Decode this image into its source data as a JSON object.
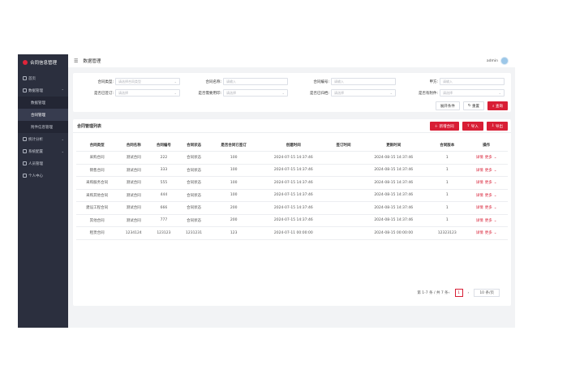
{
  "app": {
    "title": "合同信息管理"
  },
  "header": {
    "page_title": "数据管理",
    "username": "admin"
  },
  "sidebar": {
    "items": [
      {
        "label": "首页"
      },
      {
        "label": "数据管理",
        "expanded": true,
        "subs": [
          {
            "label": "数据管理"
          },
          {
            "label": "合同管理",
            "active": true
          },
          {
            "label": "附件信息管理"
          }
        ]
      },
      {
        "label": "统计分析"
      },
      {
        "label": "系统配置"
      },
      {
        "label": "人员管理"
      },
      {
        "label": "个人中心"
      }
    ]
  },
  "filter": {
    "fields": [
      {
        "label": "合同类型:",
        "placeholder": "请选择合同类型"
      },
      {
        "label": "合同名称:",
        "placeholder": "请输入"
      },
      {
        "label": "合同编号:",
        "placeholder": "请输入"
      },
      {
        "label": "甲方:",
        "placeholder": "请输入"
      },
      {
        "label": "是否已签订:",
        "placeholder": "请选择"
      },
      {
        "label": "是否需要用印:",
        "placeholder": "请选择"
      },
      {
        "label": "是否已归档:",
        "placeholder": "请选择"
      },
      {
        "label": "是否有附件:",
        "placeholder": "请选择"
      }
    ],
    "buttons": {
      "expand": "展开条件",
      "reset": "重置",
      "search": "查询"
    }
  },
  "panel": {
    "title": "合同管理列表",
    "actions": {
      "add": "新增合同",
      "import": "导入",
      "export": "导出"
    }
  },
  "table": {
    "headers": [
      "合同类型",
      "合同名称",
      "合同编号",
      "合同状态",
      "是否合同已签订",
      "创建时间",
      "签订时间",
      "更新时间",
      "合同版本",
      "操作"
    ],
    "rows": [
      [
        "采购合同",
        "测试合同",
        "222",
        "合同状态",
        "100",
        "2024-07-15 14:37:46",
        "",
        "2024-08-15 14:37:46",
        "1"
      ],
      [
        "销售合同",
        "测试合同",
        "333",
        "合同状态",
        "100",
        "2024-07-15 14:37:46",
        "",
        "2024-08-15 14:37:46",
        "1"
      ],
      [
        "采购服务合同",
        "测试合同",
        "555",
        "合同状态",
        "100",
        "2024-07-15 14:37:46",
        "",
        "2024-08-15 14:37:46",
        "1"
      ],
      [
        "采购其他合同",
        "测试合同",
        "444",
        "合同状态",
        "100",
        "2024-07-15 14:37:46",
        "",
        "2024-08-15 14:37:46",
        "1"
      ],
      [
        "建设工程合同",
        "测试合同",
        "666",
        "合同状态",
        "200",
        "2024-07-15 14:37:46",
        "",
        "2024-08-15 14:37:46",
        "1"
      ],
      [
        "其他合同",
        "测试合同",
        "777",
        "合同状态",
        "200",
        "2024-07-15 14:37:46",
        "",
        "2024-08-15 14:37:46",
        "1"
      ],
      [
        "租赁合同",
        "1234124",
        "123123",
        "1231231",
        "123",
        "2024-07-11 00:00:00",
        "",
        "2024-08-15 00:00:00",
        "12323123"
      ]
    ],
    "op_edit": "详情",
    "op_more": "更多"
  },
  "pager": {
    "summary": "第 1-7 条 / 共 7 条",
    "page": "1",
    "size": "10 条/页"
  }
}
